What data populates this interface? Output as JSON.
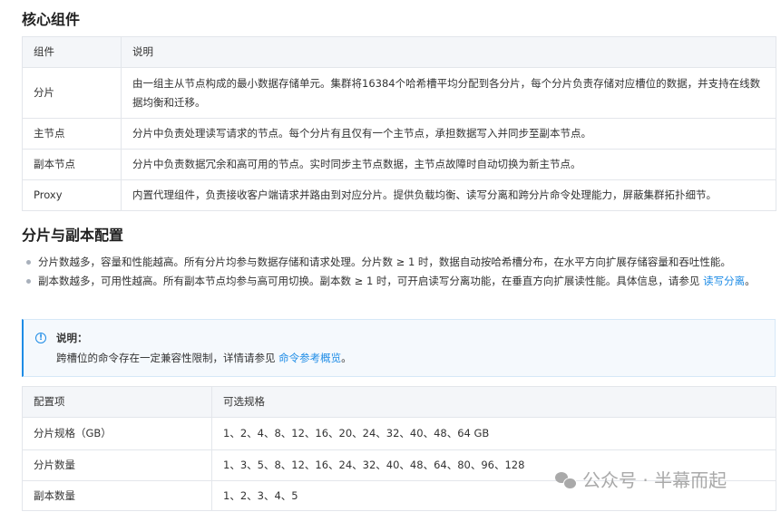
{
  "section1": {
    "title": "核心组件",
    "table": {
      "headers": [
        "组件",
        "说明"
      ],
      "rows": [
        [
          "分片",
          "由一组主从节点构成的最小数据存储单元。集群将16384个哈希槽平均分配到各分片，每个分片负责存储对应槽位的数据，并支持在线数据均衡和迁移。"
        ],
        [
          "主节点",
          "分片中负责处理读写请求的节点。每个分片有且仅有一个主节点，承担数据写入并同步至副本节点。"
        ],
        [
          "副本节点",
          "分片中负责数据冗余和高可用的节点。实时同步主节点数据，主节点故障时自动切换为新主节点。"
        ],
        [
          "Proxy",
          "内置代理组件，负责接收客户端请求并路由到对应分片。提供负载均衡、读写分离和跨分片命令处理能力，屏蔽集群拓扑细节。"
        ]
      ]
    }
  },
  "section2": {
    "title": "分片与副本配置",
    "bullets": [
      {
        "text": "分片数越多，容量和性能越高。所有分片均参与数据存储和请求处理。分片数 ≥ 1 时，数据自动按哈希槽分布，在水平方向扩展存储容量和吞吐性能。"
      },
      {
        "text": "副本数越多，可用性越高。所有副本节点均参与高可用切换。副本数 ≥ 1 时，可开启读写分离功能，在垂直方向扩展读性能。具体信息，请参见 ",
        "link": "读写分离",
        "suffix": "。"
      }
    ],
    "note": {
      "title": "说明：",
      "text": "跨槽位的命令存在一定兼容性限制，详情请参见 ",
      "link": "命令参考概览",
      "suffix": "。"
    },
    "table": {
      "headers": [
        "配置项",
        "可选规格"
      ],
      "rows": [
        [
          "分片规格（GB）",
          "1、2、4、8、12、16、20、24、32、40、48、64 GB"
        ],
        [
          "分片数量",
          "1、3、5、8、12、16、24、32、40、48、64、80、96、128"
        ],
        [
          "副本数量",
          "1、2、3、4、5"
        ]
      ]
    }
  },
  "watermark": "公众号 · 半幕而起"
}
